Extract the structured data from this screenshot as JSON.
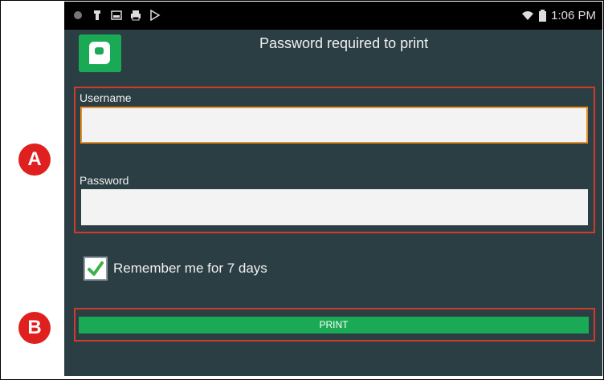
{
  "status_bar": {
    "left_icons": [
      "notification-dot-icon",
      "usb-icon",
      "image-icon",
      "print-icon",
      "play-store-icon"
    ],
    "time": "1:06 PM",
    "right_icons": [
      "wifi-icon",
      "battery-icon"
    ]
  },
  "header": {
    "app_icon": "papercut-logo-icon",
    "title": "Password required to print"
  },
  "form": {
    "username_label": "Username",
    "username_value": "",
    "password_label": "Password",
    "password_value": "",
    "remember": {
      "checked": true,
      "label": "Remember me for 7 days"
    },
    "print_label": "PRINT"
  },
  "annotations": {
    "marker_a": "A",
    "marker_b": "B",
    "color": "#d13b2b"
  },
  "colors": {
    "background": "#2b3e43",
    "accent_green": "#1aaa55",
    "focus_orange": "#e6902b"
  }
}
